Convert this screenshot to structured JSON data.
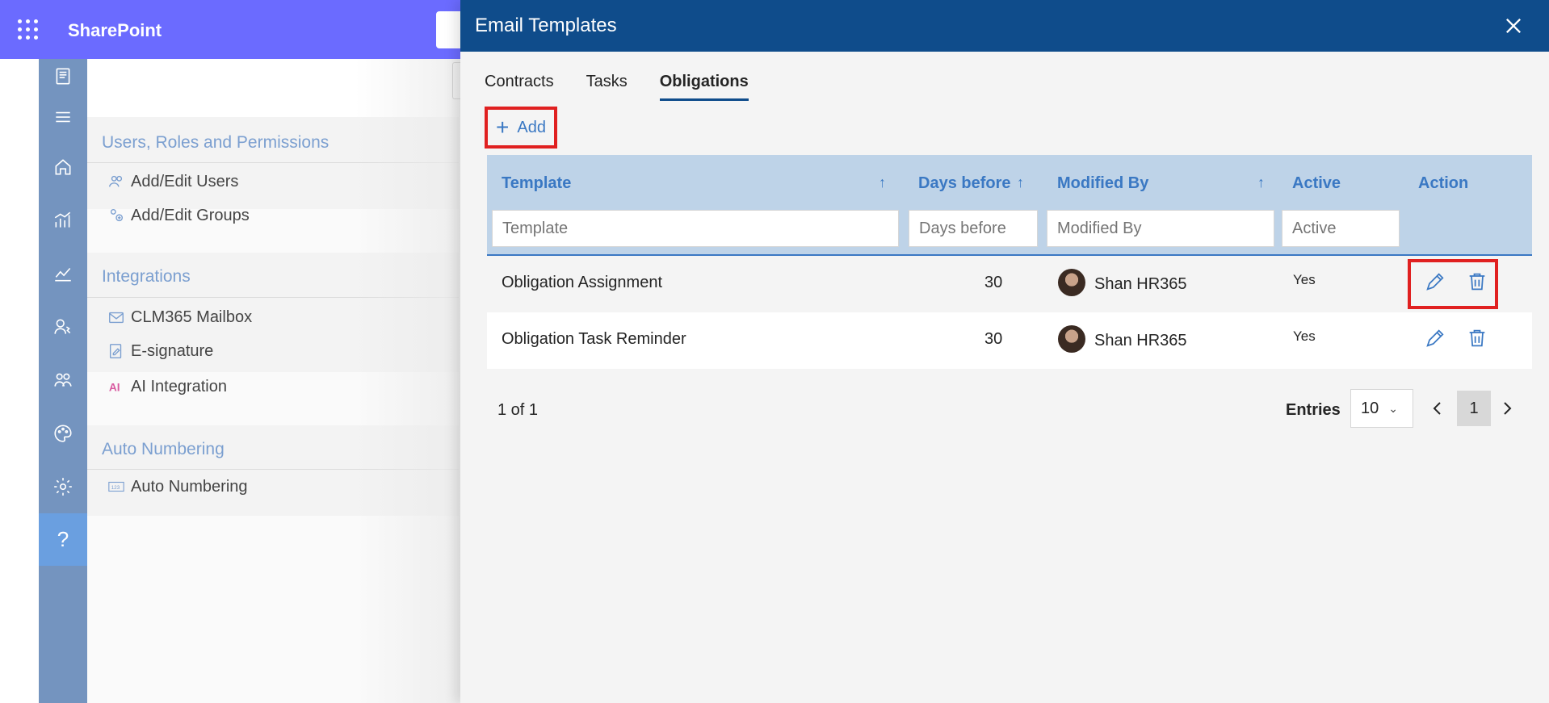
{
  "app": {
    "title": "SharePoint"
  },
  "settings": {
    "sections": [
      {
        "title": "Users, Roles and Permissions",
        "items": [
          {
            "label": "Add/Edit Users",
            "icon": "users-icon"
          },
          {
            "label": "Add/Edit Groups",
            "icon": "groups-icon"
          }
        ]
      },
      {
        "title": "Integrations",
        "items": [
          {
            "label": "CLM365 Mailbox",
            "icon": "mail-icon"
          },
          {
            "label": "E-signature",
            "icon": "signature-icon"
          },
          {
            "label": "AI Integration",
            "icon": "ai-icon"
          }
        ]
      },
      {
        "title": "Auto Numbering",
        "items": [
          {
            "label": "Auto Numbering",
            "icon": "numbering-icon"
          }
        ]
      }
    ]
  },
  "panel": {
    "title": "Email Templates",
    "tabs": [
      {
        "label": "Contracts"
      },
      {
        "label": "Tasks"
      },
      {
        "label": "Obligations",
        "active": true
      }
    ],
    "add_label": "Add",
    "columns": {
      "template": "Template",
      "days_before": "Days before",
      "modified_by": "Modified By",
      "active": "Active",
      "action": "Action"
    },
    "filters": {
      "template": "Template",
      "days_before": "Days before",
      "modified_by": "Modified By",
      "active": "Active"
    },
    "rows": [
      {
        "template": "Obligation Assignment",
        "days_before": "30",
        "modified_by": "Shan HR365",
        "active": "Yes"
      },
      {
        "template": "Obligation Task Reminder",
        "days_before": "30",
        "modified_by": "Shan HR365",
        "active": "Yes"
      }
    ],
    "footer": {
      "count": "1 of 1",
      "entries_label": "Entries",
      "entries_value": "10",
      "current_page": "1"
    }
  },
  "colors": {
    "header": "#0f4c8b",
    "suitebar": "#6b6bff",
    "accent": "#3a78c3",
    "highlight": "#e02020",
    "rail": "#7494bf"
  }
}
